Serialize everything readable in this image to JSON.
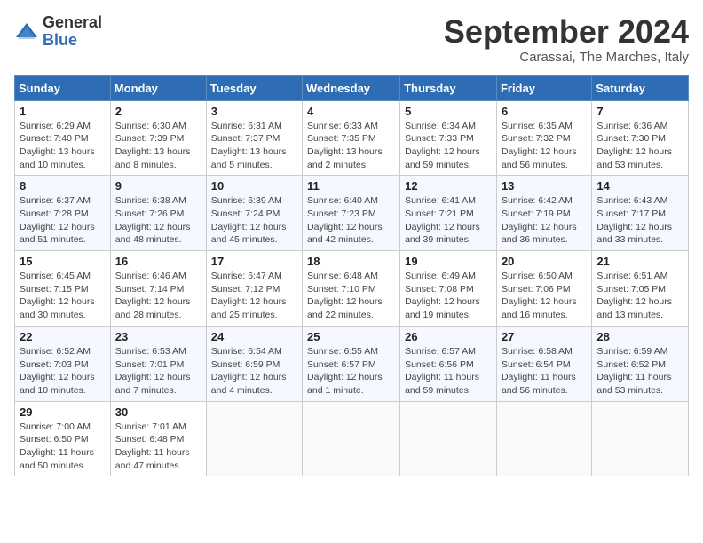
{
  "logo": {
    "general": "General",
    "blue": "Blue"
  },
  "title": "September 2024",
  "location": "Carassai, The Marches, Italy",
  "weekdays": [
    "Sunday",
    "Monday",
    "Tuesday",
    "Wednesday",
    "Thursday",
    "Friday",
    "Saturday"
  ],
  "weeks": [
    [
      {
        "day": 1,
        "sunrise": "6:29 AM",
        "sunset": "7:40 PM",
        "daylight": "13 hours and 10 minutes."
      },
      {
        "day": 2,
        "sunrise": "6:30 AM",
        "sunset": "7:39 PM",
        "daylight": "13 hours and 8 minutes."
      },
      {
        "day": 3,
        "sunrise": "6:31 AM",
        "sunset": "7:37 PM",
        "daylight": "13 hours and 5 minutes."
      },
      {
        "day": 4,
        "sunrise": "6:33 AM",
        "sunset": "7:35 PM",
        "daylight": "13 hours and 2 minutes."
      },
      {
        "day": 5,
        "sunrise": "6:34 AM",
        "sunset": "7:33 PM",
        "daylight": "12 hours and 59 minutes."
      },
      {
        "day": 6,
        "sunrise": "6:35 AM",
        "sunset": "7:32 PM",
        "daylight": "12 hours and 56 minutes."
      },
      {
        "day": 7,
        "sunrise": "6:36 AM",
        "sunset": "7:30 PM",
        "daylight": "12 hours and 53 minutes."
      }
    ],
    [
      {
        "day": 8,
        "sunrise": "6:37 AM",
        "sunset": "7:28 PM",
        "daylight": "12 hours and 51 minutes."
      },
      {
        "day": 9,
        "sunrise": "6:38 AM",
        "sunset": "7:26 PM",
        "daylight": "12 hours and 48 minutes."
      },
      {
        "day": 10,
        "sunrise": "6:39 AM",
        "sunset": "7:24 PM",
        "daylight": "12 hours and 45 minutes."
      },
      {
        "day": 11,
        "sunrise": "6:40 AM",
        "sunset": "7:23 PM",
        "daylight": "12 hours and 42 minutes."
      },
      {
        "day": 12,
        "sunrise": "6:41 AM",
        "sunset": "7:21 PM",
        "daylight": "12 hours and 39 minutes."
      },
      {
        "day": 13,
        "sunrise": "6:42 AM",
        "sunset": "7:19 PM",
        "daylight": "12 hours and 36 minutes."
      },
      {
        "day": 14,
        "sunrise": "6:43 AM",
        "sunset": "7:17 PM",
        "daylight": "12 hours and 33 minutes."
      }
    ],
    [
      {
        "day": 15,
        "sunrise": "6:45 AM",
        "sunset": "7:15 PM",
        "daylight": "12 hours and 30 minutes."
      },
      {
        "day": 16,
        "sunrise": "6:46 AM",
        "sunset": "7:14 PM",
        "daylight": "12 hours and 28 minutes."
      },
      {
        "day": 17,
        "sunrise": "6:47 AM",
        "sunset": "7:12 PM",
        "daylight": "12 hours and 25 minutes."
      },
      {
        "day": 18,
        "sunrise": "6:48 AM",
        "sunset": "7:10 PM",
        "daylight": "12 hours and 22 minutes."
      },
      {
        "day": 19,
        "sunrise": "6:49 AM",
        "sunset": "7:08 PM",
        "daylight": "12 hours and 19 minutes."
      },
      {
        "day": 20,
        "sunrise": "6:50 AM",
        "sunset": "7:06 PM",
        "daylight": "12 hours and 16 minutes."
      },
      {
        "day": 21,
        "sunrise": "6:51 AM",
        "sunset": "7:05 PM",
        "daylight": "12 hours and 13 minutes."
      }
    ],
    [
      {
        "day": 22,
        "sunrise": "6:52 AM",
        "sunset": "7:03 PM",
        "daylight": "12 hours and 10 minutes."
      },
      {
        "day": 23,
        "sunrise": "6:53 AM",
        "sunset": "7:01 PM",
        "daylight": "12 hours and 7 minutes."
      },
      {
        "day": 24,
        "sunrise": "6:54 AM",
        "sunset": "6:59 PM",
        "daylight": "12 hours and 4 minutes."
      },
      {
        "day": 25,
        "sunrise": "6:55 AM",
        "sunset": "6:57 PM",
        "daylight": "12 hours and 1 minute."
      },
      {
        "day": 26,
        "sunrise": "6:57 AM",
        "sunset": "6:56 PM",
        "daylight": "11 hours and 59 minutes."
      },
      {
        "day": 27,
        "sunrise": "6:58 AM",
        "sunset": "6:54 PM",
        "daylight": "11 hours and 56 minutes."
      },
      {
        "day": 28,
        "sunrise": "6:59 AM",
        "sunset": "6:52 PM",
        "daylight": "11 hours and 53 minutes."
      }
    ],
    [
      {
        "day": 29,
        "sunrise": "7:00 AM",
        "sunset": "6:50 PM",
        "daylight": "11 hours and 50 minutes."
      },
      {
        "day": 30,
        "sunrise": "7:01 AM",
        "sunset": "6:48 PM",
        "daylight": "11 hours and 47 minutes."
      },
      null,
      null,
      null,
      null,
      null
    ]
  ]
}
